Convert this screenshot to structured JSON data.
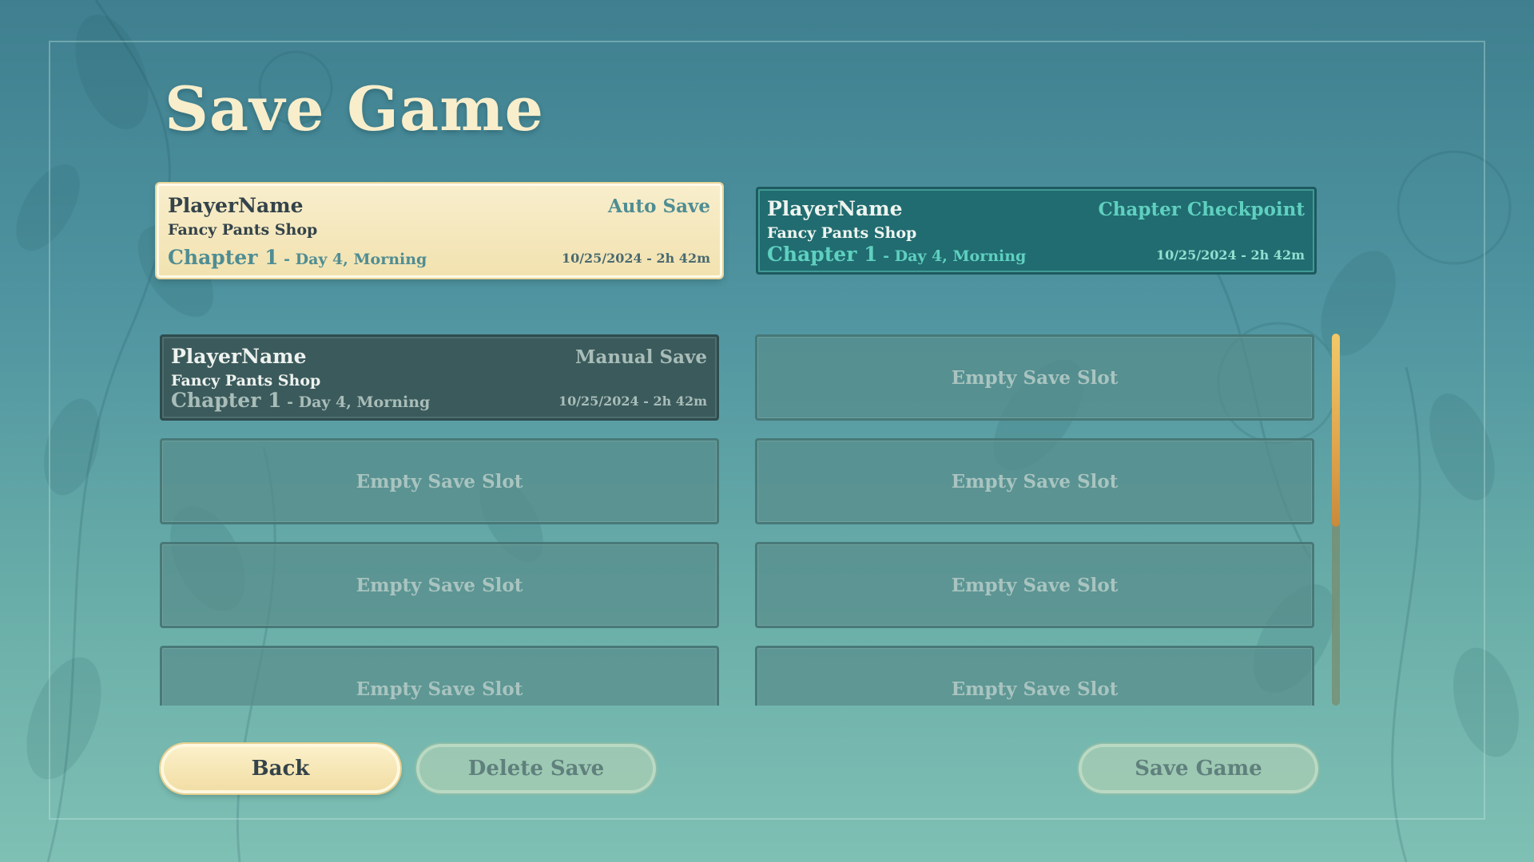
{
  "title": "Save Game",
  "colors": {
    "accent_cream": "#f8eecb",
    "teal_dark": "#216c70",
    "teal_highlight": "#5fd0c0",
    "manual_slot": "#3b5a5c",
    "scroll_thumb": "#e0a44c"
  },
  "top_slots": [
    {
      "player": "PlayerName",
      "type": "Auto Save",
      "location": "Fancy Pants Shop",
      "chapter": "Chapter 1",
      "day": " - Day 4, Morning",
      "timestamp": "10/25/2024 - 2h 42m"
    },
    {
      "player": "PlayerName",
      "type": "Chapter Checkpoint",
      "location": "Fancy Pants Shop",
      "chapter": "Chapter 1",
      "day": " - Day 4, Morning",
      "timestamp": "10/25/2024 - 2h 42m"
    }
  ],
  "manual_slot": {
    "player": "PlayerName",
    "type": "Manual Save",
    "location": "Fancy Pants Shop",
    "chapter": "Chapter 1",
    "day": " - Day 4, Morning",
    "timestamp": "10/25/2024 - 2h 42m"
  },
  "empty_label": "Empty Save Slot",
  "scrollbar": {
    "position_fraction": 0.0,
    "visible_fraction": 0.52
  },
  "buttons": {
    "back": "Back",
    "delete": "Delete Save",
    "save": "Save Game"
  }
}
